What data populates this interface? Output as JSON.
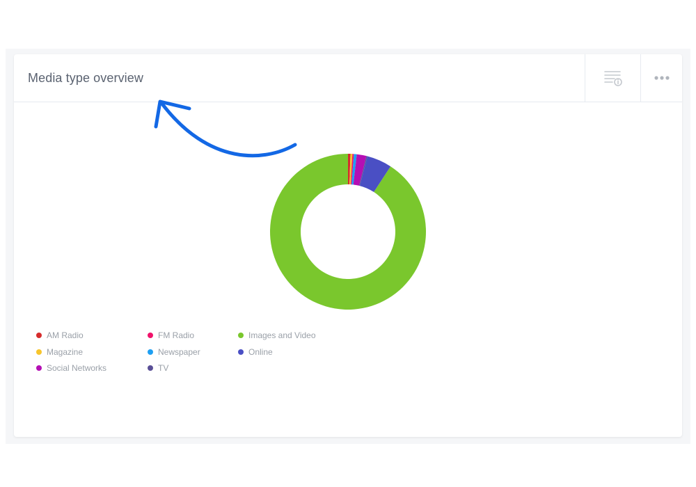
{
  "card": {
    "title": "Media type overview"
  },
  "header_actions": {
    "info_icon": "list-info-icon",
    "more_icon": "more-horizontal-icon"
  },
  "colors": {
    "am_radio": "#d62d2d",
    "fm_radio": "#f0136b",
    "images_video": "#7ac72d",
    "magazine": "#f7c52d",
    "newspaper": "#1e9ff2",
    "online": "#4a4fc4",
    "social_networks": "#b40fb4",
    "tv": "#5a4f96",
    "annotation_arrow": "#1368e5"
  },
  "chart_data": {
    "type": "pie",
    "donut": true,
    "categories": [
      "AM Radio",
      "FM Radio",
      "Images and Video",
      "Magazine",
      "Newspaper",
      "Online",
      "Social Networks",
      "TV"
    ],
    "values": [
      0.5,
      0.3,
      90.8,
      0.4,
      0.6,
      5.2,
      2.0,
      0.2
    ],
    "legend_position": "bottom-left"
  },
  "legend": [
    {
      "label": "AM Radio",
      "color": "#d62d2d"
    },
    {
      "label": "FM Radio",
      "color": "#f0136b"
    },
    {
      "label": "Images and Video",
      "color": "#7ac72d"
    },
    {
      "label": "Magazine",
      "color": "#f7c52d"
    },
    {
      "label": "Newspaper",
      "color": "#1e9ff2"
    },
    {
      "label": "Online",
      "color": "#4a4fc4"
    },
    {
      "label": "Social Networks",
      "color": "#b40fb4"
    },
    {
      "label": "TV",
      "color": "#5a4f96"
    }
  ]
}
